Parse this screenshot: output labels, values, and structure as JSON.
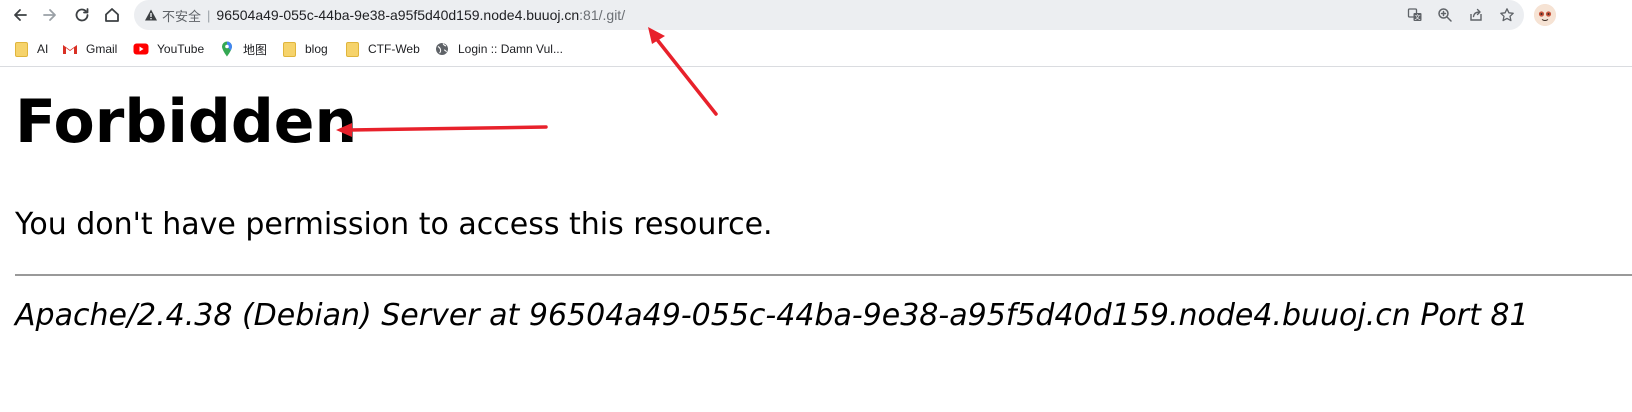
{
  "browser": {
    "security_label": "不安全",
    "separator": "|",
    "url_host": "96504a49-055c-44ba-9e38-a95f5d40d159.node4.buuoj.cn",
    "url_rest": ":81/.git/",
    "icons": [
      "back-icon",
      "forward-icon",
      "reload-icon",
      "home-icon",
      "warning-icon",
      "translate-icon",
      "zoom-icon",
      "share-icon",
      "star-icon",
      "profile-avatar"
    ]
  },
  "bookmarks": [
    {
      "label": "AI",
      "icon": "folder-icon"
    },
    {
      "label": "Gmail",
      "icon": "gmail-icon"
    },
    {
      "label": "YouTube",
      "icon": "youtube-icon"
    },
    {
      "label": "地图",
      "icon": "maps-icon"
    },
    {
      "label": "blog",
      "icon": "folder-icon"
    },
    {
      "label": "CTF-Web",
      "icon": "folder-icon"
    },
    {
      "label": "Login :: Damn Vul...",
      "icon": "globe-icon"
    }
  ],
  "page": {
    "heading": "Forbidden",
    "message": "You don't have permission to access this resource.",
    "address": "Apache/2.4.38 (Debian) Server at 96504a49-055c-44ba-9e38-a95f5d40d159.node4.buuoj.cn Port 81"
  },
  "colors": {
    "annotation_arrow": "#e8212b",
    "omnibox_bg": "#eceef1",
    "rule": "#999999"
  }
}
